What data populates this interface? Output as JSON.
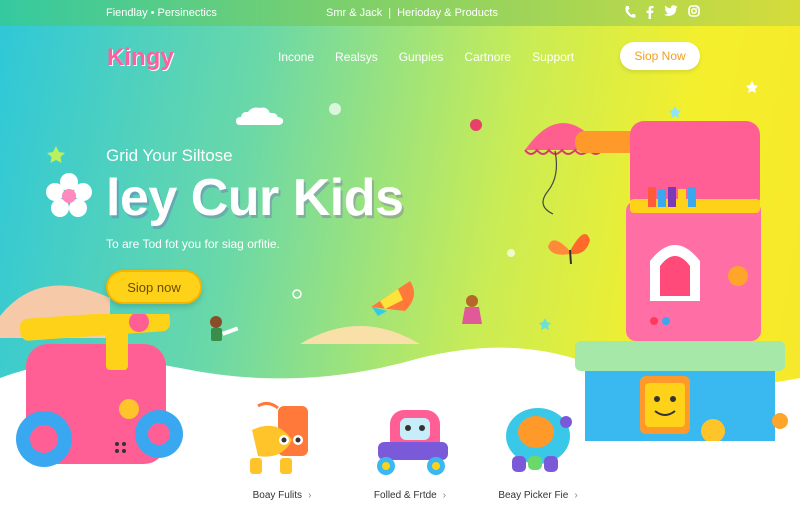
{
  "topbar": {
    "left_text": "Fiendlay • Persinectics",
    "mid_left": "Smr & Jack",
    "mid_sep": "|",
    "mid_right": "Herioday & Products"
  },
  "header": {
    "logo": "Kingy",
    "nav": [
      "Incone",
      "Realsys",
      "Gunpies",
      "Cartnore",
      "Support"
    ],
    "shop_button": "Siop Now"
  },
  "hero": {
    "subhead": "Grid Your Siltose",
    "headline": "ley Cur Kids",
    "tagline": "To are Tod fot you for siag orfitie.",
    "shop_button": "Siop now"
  },
  "products": [
    {
      "label": "Boay Fulits",
      "arrow": "›"
    },
    {
      "label": "Folled & Frtde",
      "arrow": "›"
    },
    {
      "label": "Beay Picker Fie",
      "arrow": "›"
    }
  ],
  "colors": {
    "accent_yellow": "#ffd21a",
    "logo_pink": "#ff5fa0",
    "gradient_start": "#2fc8d8",
    "gradient_end": "#f7e72a"
  },
  "icons": [
    "phone-icon",
    "facebook-icon",
    "twitter-icon",
    "instagram-icon"
  ]
}
